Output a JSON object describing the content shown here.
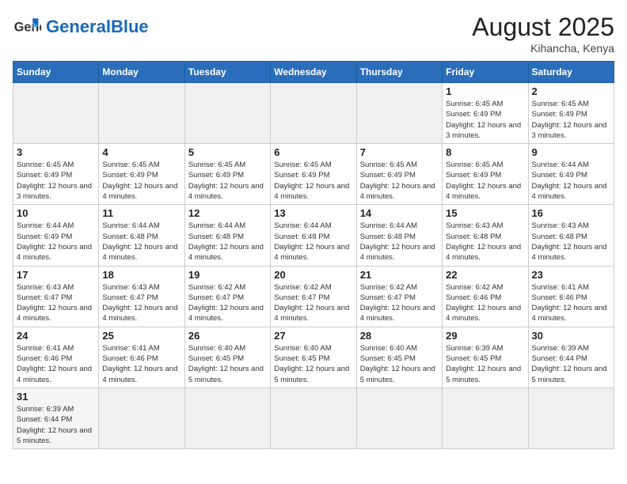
{
  "header": {
    "logo_general": "General",
    "logo_blue": "Blue",
    "month_title": "August 2025",
    "subtitle": "Kihancha, Kenya"
  },
  "days_of_week": [
    "Sunday",
    "Monday",
    "Tuesday",
    "Wednesday",
    "Thursday",
    "Friday",
    "Saturday"
  ],
  "weeks": [
    [
      {
        "day": "",
        "info": ""
      },
      {
        "day": "",
        "info": ""
      },
      {
        "day": "",
        "info": ""
      },
      {
        "day": "",
        "info": ""
      },
      {
        "day": "",
        "info": ""
      },
      {
        "day": "1",
        "info": "Sunrise: 6:45 AM\nSunset: 6:49 PM\nDaylight: 12 hours and 3 minutes."
      },
      {
        "day": "2",
        "info": "Sunrise: 6:45 AM\nSunset: 6:49 PM\nDaylight: 12 hours and 3 minutes."
      }
    ],
    [
      {
        "day": "3",
        "info": "Sunrise: 6:45 AM\nSunset: 6:49 PM\nDaylight: 12 hours and 3 minutes."
      },
      {
        "day": "4",
        "info": "Sunrise: 6:45 AM\nSunset: 6:49 PM\nDaylight: 12 hours and 4 minutes."
      },
      {
        "day": "5",
        "info": "Sunrise: 6:45 AM\nSunset: 6:49 PM\nDaylight: 12 hours and 4 minutes."
      },
      {
        "day": "6",
        "info": "Sunrise: 6:45 AM\nSunset: 6:49 PM\nDaylight: 12 hours and 4 minutes."
      },
      {
        "day": "7",
        "info": "Sunrise: 6:45 AM\nSunset: 6:49 PM\nDaylight: 12 hours and 4 minutes."
      },
      {
        "day": "8",
        "info": "Sunrise: 6:45 AM\nSunset: 6:49 PM\nDaylight: 12 hours and 4 minutes."
      },
      {
        "day": "9",
        "info": "Sunrise: 6:44 AM\nSunset: 6:49 PM\nDaylight: 12 hours and 4 minutes."
      }
    ],
    [
      {
        "day": "10",
        "info": "Sunrise: 6:44 AM\nSunset: 6:49 PM\nDaylight: 12 hours and 4 minutes."
      },
      {
        "day": "11",
        "info": "Sunrise: 6:44 AM\nSunset: 6:48 PM\nDaylight: 12 hours and 4 minutes."
      },
      {
        "day": "12",
        "info": "Sunrise: 6:44 AM\nSunset: 6:48 PM\nDaylight: 12 hours and 4 minutes."
      },
      {
        "day": "13",
        "info": "Sunrise: 6:44 AM\nSunset: 6:48 PM\nDaylight: 12 hours and 4 minutes."
      },
      {
        "day": "14",
        "info": "Sunrise: 6:44 AM\nSunset: 6:48 PM\nDaylight: 12 hours and 4 minutes."
      },
      {
        "day": "15",
        "info": "Sunrise: 6:43 AM\nSunset: 6:48 PM\nDaylight: 12 hours and 4 minutes."
      },
      {
        "day": "16",
        "info": "Sunrise: 6:43 AM\nSunset: 6:48 PM\nDaylight: 12 hours and 4 minutes."
      }
    ],
    [
      {
        "day": "17",
        "info": "Sunrise: 6:43 AM\nSunset: 6:47 PM\nDaylight: 12 hours and 4 minutes."
      },
      {
        "day": "18",
        "info": "Sunrise: 6:43 AM\nSunset: 6:47 PM\nDaylight: 12 hours and 4 minutes."
      },
      {
        "day": "19",
        "info": "Sunrise: 6:42 AM\nSunset: 6:47 PM\nDaylight: 12 hours and 4 minutes."
      },
      {
        "day": "20",
        "info": "Sunrise: 6:42 AM\nSunset: 6:47 PM\nDaylight: 12 hours and 4 minutes."
      },
      {
        "day": "21",
        "info": "Sunrise: 6:42 AM\nSunset: 6:47 PM\nDaylight: 12 hours and 4 minutes."
      },
      {
        "day": "22",
        "info": "Sunrise: 6:42 AM\nSunset: 6:46 PM\nDaylight: 12 hours and 4 minutes."
      },
      {
        "day": "23",
        "info": "Sunrise: 6:41 AM\nSunset: 6:46 PM\nDaylight: 12 hours and 4 minutes."
      }
    ],
    [
      {
        "day": "24",
        "info": "Sunrise: 6:41 AM\nSunset: 6:46 PM\nDaylight: 12 hours and 4 minutes."
      },
      {
        "day": "25",
        "info": "Sunrise: 6:41 AM\nSunset: 6:46 PM\nDaylight: 12 hours and 4 minutes."
      },
      {
        "day": "26",
        "info": "Sunrise: 6:40 AM\nSunset: 6:45 PM\nDaylight: 12 hours and 5 minutes."
      },
      {
        "day": "27",
        "info": "Sunrise: 6:40 AM\nSunset: 6:45 PM\nDaylight: 12 hours and 5 minutes."
      },
      {
        "day": "28",
        "info": "Sunrise: 6:40 AM\nSunset: 6:45 PM\nDaylight: 12 hours and 5 minutes."
      },
      {
        "day": "29",
        "info": "Sunrise: 6:39 AM\nSunset: 6:45 PM\nDaylight: 12 hours and 5 minutes."
      },
      {
        "day": "30",
        "info": "Sunrise: 6:39 AM\nSunset: 6:44 PM\nDaylight: 12 hours and 5 minutes."
      }
    ],
    [
      {
        "day": "31",
        "info": "Sunrise: 6:39 AM\nSunset: 6:44 PM\nDaylight: 12 hours and 5 minutes."
      },
      {
        "day": "",
        "info": ""
      },
      {
        "day": "",
        "info": ""
      },
      {
        "day": "",
        "info": ""
      },
      {
        "day": "",
        "info": ""
      },
      {
        "day": "",
        "info": ""
      },
      {
        "day": "",
        "info": ""
      }
    ]
  ]
}
